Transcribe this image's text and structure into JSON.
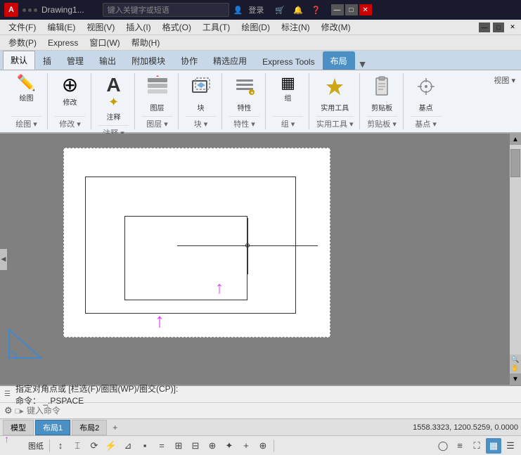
{
  "titlebar": {
    "app_icon": "A",
    "filename": "Drawing1...",
    "search_placeholder": "键入关键字或短语",
    "user": "登录",
    "win_buttons": [
      "—",
      "□",
      "✕"
    ]
  },
  "menubar1": {
    "items": [
      "文件(F)",
      "编辑(E)",
      "视图(V)",
      "插入(I)",
      "格式(O)",
      "工具(T)",
      "绘图(D)",
      "标注(N)",
      "修改(M)"
    ]
  },
  "menubar2": {
    "items": [
      "参数(P)",
      "Express",
      "窗口(W)",
      "帮助(H)"
    ]
  },
  "ribbon_tabs": {
    "items": [
      "默认",
      "插",
      "管理",
      "输出",
      "附加模块",
      "协作",
      "精选应用",
      "Express Tools",
      "布局"
    ]
  },
  "ribbon_groups": [
    {
      "label": "绘图",
      "tools": [
        {
          "icon": "✏️",
          "label": ""
        }
      ]
    },
    {
      "label": "修改",
      "tools": [
        {
          "icon": "⊕",
          "label": ""
        }
      ]
    },
    {
      "label": "注释",
      "tools": [
        {
          "icon": "A",
          "label": ""
        }
      ]
    },
    {
      "label": "图层",
      "tools": [
        {
          "icon": "📋",
          "label": ""
        }
      ]
    },
    {
      "label": "块",
      "tools": [
        {
          "icon": "📦",
          "label": ""
        }
      ]
    },
    {
      "label": "特性",
      "tools": [
        {
          "icon": "🔧",
          "label": ""
        }
      ]
    },
    {
      "label": "组",
      "tools": [
        {
          "icon": "▦",
          "label": ""
        }
      ]
    },
    {
      "label": "实用工具",
      "tools": [
        {
          "icon": "✦",
          "label": ""
        }
      ]
    },
    {
      "label": "剪贴板",
      "tools": [
        {
          "icon": "📄",
          "label": ""
        }
      ]
    },
    {
      "label": "基点",
      "tools": [
        {
          "icon": "◈",
          "label": ""
        }
      ]
    }
  ],
  "command": {
    "text1": "指定对角点或 [栏选(F)/圈围(WP)/圈交(CP)]:",
    "text2": "命令： _.PSPACE",
    "prompt_icon": "⚙",
    "input_placeholder": "键入命令"
  },
  "status": {
    "tabs": [
      "模型",
      "布局1",
      "布局2"
    ],
    "coords": "1558.3323, 1200.5259, 0.0000"
  },
  "bottom_tools": [
    "图纸",
    "↕",
    "⌀",
    "⟳",
    "⚡",
    "⊿",
    "▪",
    "≡",
    "⊞",
    "⊟",
    "⊕",
    "⊕",
    "✦",
    "+",
    "⊕",
    "◯",
    "≡"
  ]
}
